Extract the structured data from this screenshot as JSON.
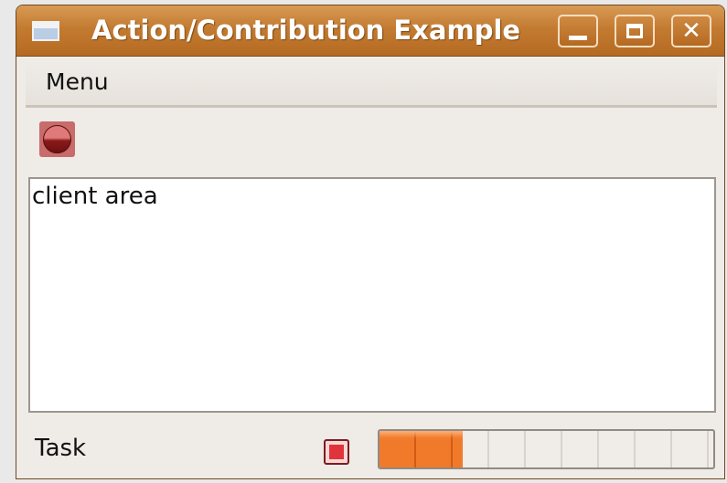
{
  "window": {
    "title": "Action/Contribution Example",
    "icon": "window-icon",
    "controls": [
      "minimize-icon",
      "maximize-icon",
      "close-icon"
    ],
    "titlebar_color": "#c37b31"
  },
  "menubar": {
    "items": [
      {
        "label": "Menu"
      }
    ]
  },
  "toolbar": {
    "buttons": [
      {
        "icon": "stop-icon",
        "color": "#a23030"
      }
    ]
  },
  "client_area": {
    "text": "client area"
  },
  "statusbar": {
    "task_label": "Task",
    "stop_icon": "stop-icon",
    "progress_fraction": 0.25,
    "progress_color": "#f07a2a"
  }
}
